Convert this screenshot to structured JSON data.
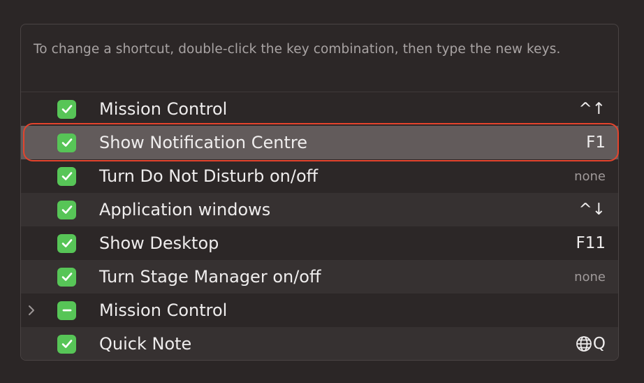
{
  "instructions": "To change a shortcut, double-click the key combination, then type the new keys.",
  "rows": [
    {
      "label": "Mission Control",
      "shortcut": "^↑",
      "state": "checked"
    },
    {
      "label": "Show Notification Centre",
      "shortcut": "F1",
      "state": "checked",
      "selected": true
    },
    {
      "label": "Turn Do Not Disturb on/off",
      "shortcut": "none",
      "state": "checked"
    },
    {
      "label": "Application windows",
      "shortcut": "^↓",
      "state": "checked"
    },
    {
      "label": "Show Desktop",
      "shortcut": "F11",
      "state": "checked"
    },
    {
      "label": "Turn Stage Manager on/off",
      "shortcut": "none",
      "state": "checked"
    },
    {
      "label": "Mission Control",
      "shortcut": "",
      "state": "mixed",
      "expandable": true
    },
    {
      "label": "Quick Note",
      "shortcut": "Q",
      "shortcut_icon": "globe-icon",
      "state": "checked"
    }
  ],
  "colors": {
    "checkbox": "#57c557",
    "selected_row": "#625b5b",
    "highlight_outline": "#e4442d"
  }
}
